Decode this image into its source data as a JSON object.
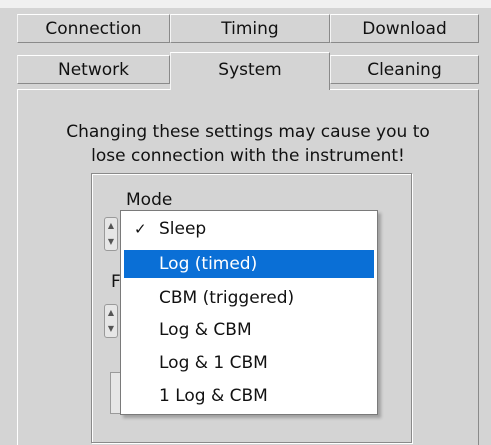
{
  "tabs": {
    "row1": [
      "Connection",
      "Timing",
      "Download"
    ],
    "row2": [
      "Network",
      "System",
      "Cleaning"
    ],
    "selected": "System"
  },
  "warning": {
    "line1": "Changing these settings may cause you to",
    "line2": "lose connection with the instrument!"
  },
  "mode": {
    "label": "Mode",
    "second_label_fragment": "F"
  },
  "menu": {
    "items": [
      "Sleep",
      "Log (timed)",
      "CBM (triggered)",
      "Log & CBM",
      "Log & 1 CBM",
      "1 Log & CBM"
    ],
    "checked": "Sleep",
    "highlighted": "Log (timed)",
    "check_glyph": "✓"
  },
  "colors": {
    "panel_bg": "#d4d4d4",
    "highlight": "#0a6fd6",
    "menu_bg": "#ffffff"
  }
}
